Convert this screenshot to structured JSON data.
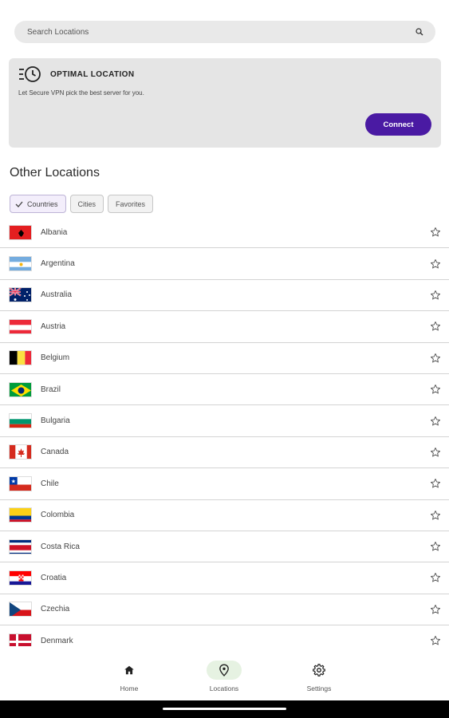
{
  "search": {
    "placeholder": "Search Locations"
  },
  "optimal": {
    "title": "OPTIMAL LOCATION",
    "description": "Let Secure VPN pick the best server for you.",
    "connect_label": "Connect"
  },
  "other_locations_title": "Other Locations",
  "filters": [
    {
      "label": "Countries",
      "active": true
    },
    {
      "label": "Cities",
      "active": false
    },
    {
      "label": "Favorites",
      "active": false
    }
  ],
  "countries": [
    {
      "name": "Albania",
      "flag": "albania-flag-icon"
    },
    {
      "name": "Argentina",
      "flag": "argentina-flag-icon"
    },
    {
      "name": "Australia",
      "flag": "australia-flag-icon"
    },
    {
      "name": "Austria",
      "flag": "austria-flag-icon"
    },
    {
      "name": "Belgium",
      "flag": "belgium-flag-icon"
    },
    {
      "name": "Brazil",
      "flag": "brazil-flag-icon"
    },
    {
      "name": "Bulgaria",
      "flag": "bulgaria-flag-icon"
    },
    {
      "name": "Canada",
      "flag": "canada-flag-icon"
    },
    {
      "name": "Chile",
      "flag": "chile-flag-icon"
    },
    {
      "name": "Colombia",
      "flag": "colombia-flag-icon"
    },
    {
      "name": "Costa Rica",
      "flag": "costa-rica-flag-icon"
    },
    {
      "name": "Croatia",
      "flag": "croatia-flag-icon"
    },
    {
      "name": "Czechia",
      "flag": "czechia-flag-icon"
    },
    {
      "name": "Denmark",
      "flag": "denmark-flag-icon"
    }
  ],
  "nav": [
    {
      "label": "Home",
      "icon": "home-icon",
      "active": false
    },
    {
      "label": "Locations",
      "icon": "location-pin-icon",
      "active": true
    },
    {
      "label": "Settings",
      "icon": "gear-icon",
      "active": false
    }
  ],
  "colors": {
    "accent": "#4a1aa3",
    "nav_active": "#e6f2e2"
  }
}
